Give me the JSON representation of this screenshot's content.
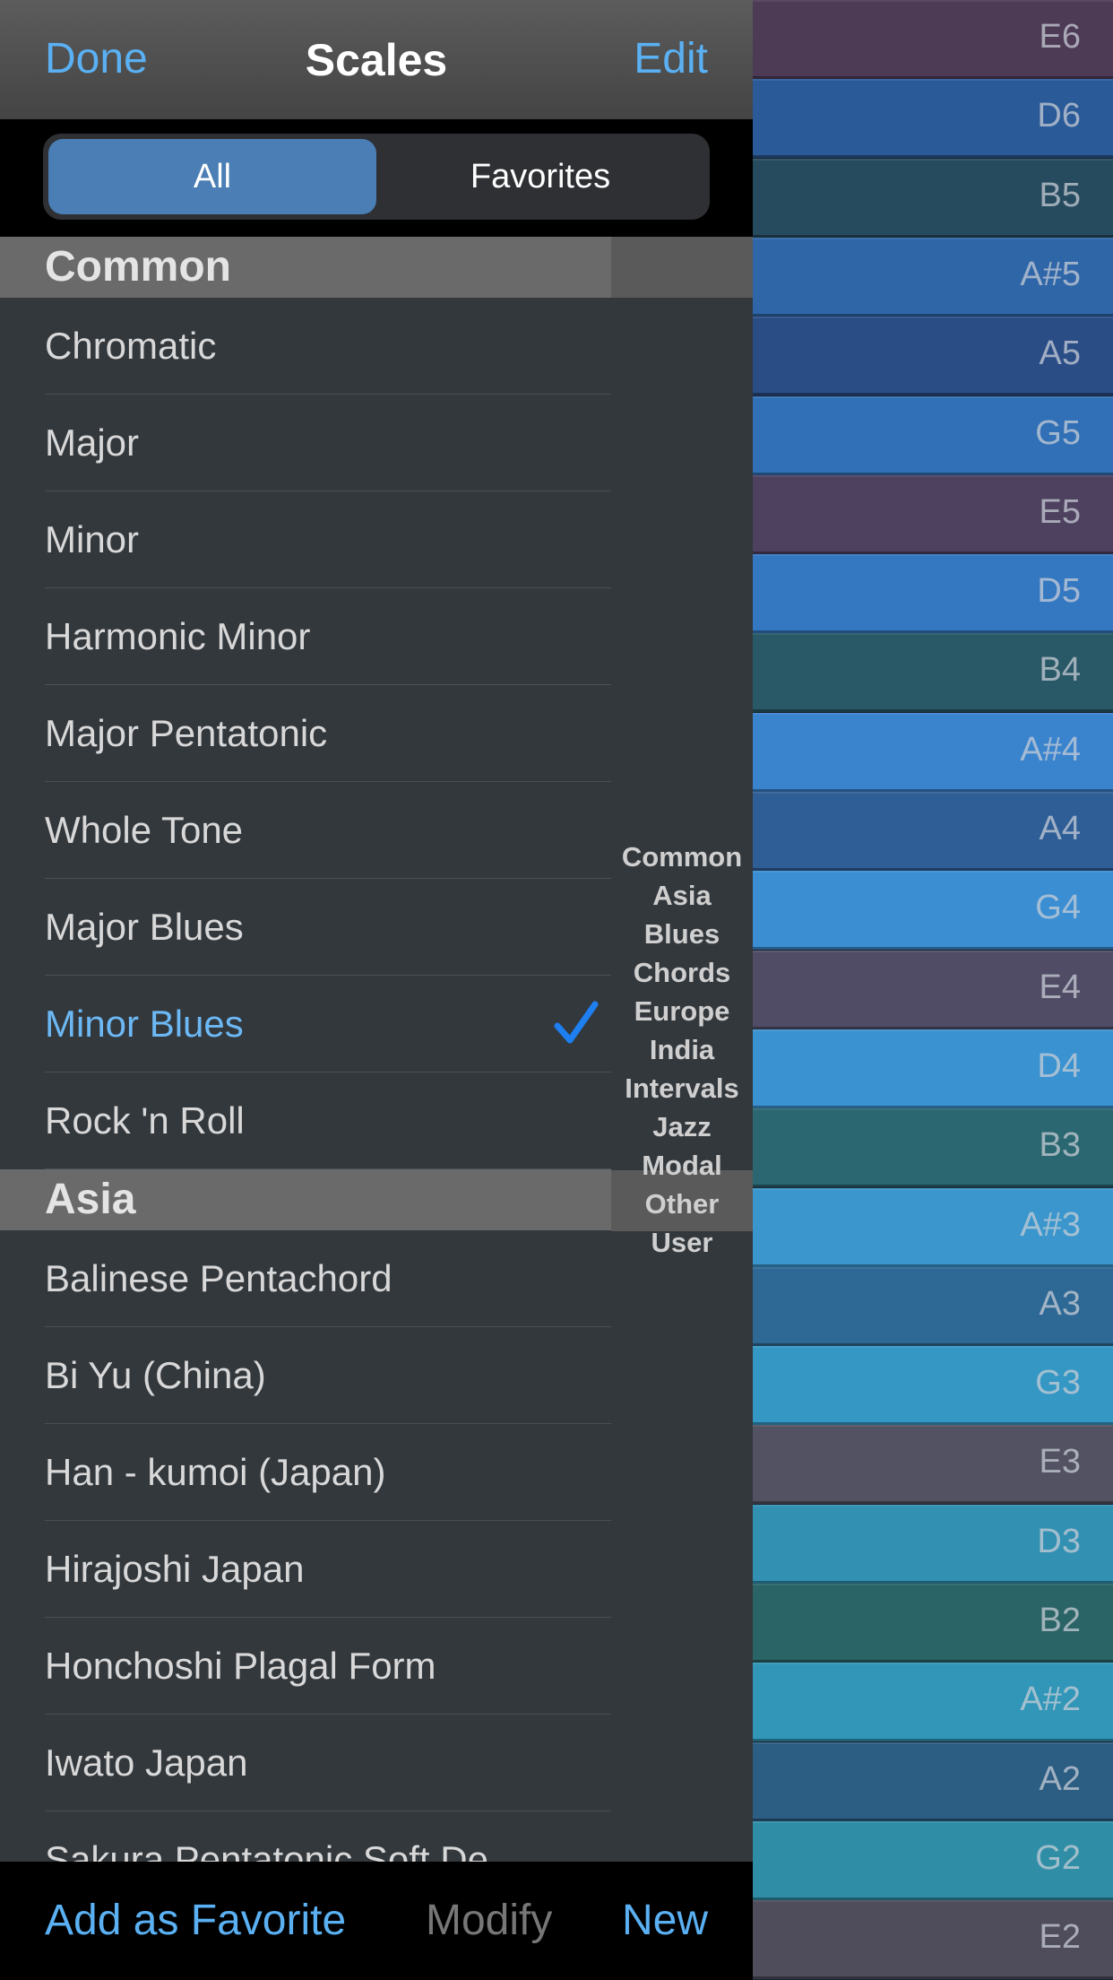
{
  "nav": {
    "done": "Done",
    "title": "Scales",
    "edit": "Edit"
  },
  "segment": {
    "all": "All",
    "favorites": "Favorites"
  },
  "sections": [
    {
      "title": "Common",
      "items": [
        "Chromatic",
        "Major",
        "Minor",
        "Harmonic Minor",
        "Major Pentatonic",
        "Whole Tone",
        "Major Blues",
        "Minor Blues",
        "Rock 'n Roll"
      ]
    },
    {
      "title": "Asia",
      "items": [
        "Balinese Pentachord",
        "Bi Yu (China)",
        "Han - kumoi (Japan)",
        "Hirajoshi Japan",
        "Honchoshi Plagal Form",
        "Iwato Japan",
        "Sakura Pentatonic Soft De"
      ]
    }
  ],
  "selected_item": "Minor Blues",
  "index": [
    "Common",
    "Asia",
    "Blues",
    "Chords",
    "Europe",
    "India",
    "Intervals",
    "Jazz",
    "Modal",
    "Other",
    "User"
  ],
  "toolbar": {
    "add_favorite": "Add as Favorite",
    "modify": "Modify",
    "new": "New"
  },
  "keys": [
    {
      "note": "E6",
      "color": "#4d3a55"
    },
    {
      "note": "D6",
      "color": "#2a5a97"
    },
    {
      "note": "B5",
      "color": "#274b5e"
    },
    {
      "note": "A#5",
      "color": "#2f66a8"
    },
    {
      "note": "A5",
      "color": "#2b4d86"
    },
    {
      "note": "G5",
      "color": "#3170b6"
    },
    {
      "note": "E5",
      "color": "#4e4160"
    },
    {
      "note": "D5",
      "color": "#3578c2"
    },
    {
      "note": "B4",
      "color": "#295866"
    },
    {
      "note": "A#4",
      "color": "#3a83cd"
    },
    {
      "note": "A4",
      "color": "#2f5e96"
    },
    {
      "note": "G4",
      "color": "#3b8ed2"
    },
    {
      "note": "E4",
      "color": "#504c66"
    },
    {
      "note": "D4",
      "color": "#3b92d0"
    },
    {
      "note": "B3",
      "color": "#2b6770"
    },
    {
      "note": "A#3",
      "color": "#3a96cc"
    },
    {
      "note": "A3",
      "color": "#2e6894"
    },
    {
      "note": "G3",
      "color": "#3497c4"
    },
    {
      "note": "E3",
      "color": "#525262"
    },
    {
      "note": "D3",
      "color": "#3290b2"
    },
    {
      "note": "B2",
      "color": "#2a6466"
    },
    {
      "note": "A#2",
      "color": "#3196b8"
    },
    {
      "note": "A2",
      "color": "#2c5d82"
    },
    {
      "note": "G2",
      "color": "#2f8ea6"
    },
    {
      "note": "E2",
      "color": "#4f4c5c"
    }
  ]
}
